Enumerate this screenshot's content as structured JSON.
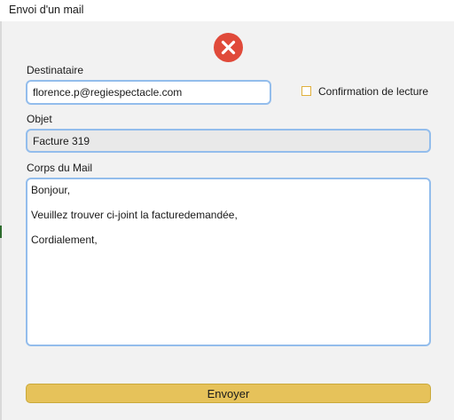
{
  "window": {
    "title": "Envoi d'un mail"
  },
  "colors": {
    "accent_field_border": "#93bdec",
    "send_button": "#e6c25a",
    "close_button": "#e04a3a"
  },
  "form": {
    "recipient_label": "Destinataire",
    "recipient_value": "florence.p@regiespectacle.com",
    "read_receipt_label": "Confirmation de lecture",
    "read_receipt_checked": false,
    "subject_label": "Objet",
    "subject_value": "Facture 319",
    "body_label": "Corps du Mail",
    "body_lines": [
      "Bonjour,",
      "",
      "Veuillez trouver ci-joint la facturedemandée,",
      "",
      "Cordialement,"
    ]
  },
  "actions": {
    "send_label": "Envoyer",
    "close_icon": "close-x-icon"
  }
}
